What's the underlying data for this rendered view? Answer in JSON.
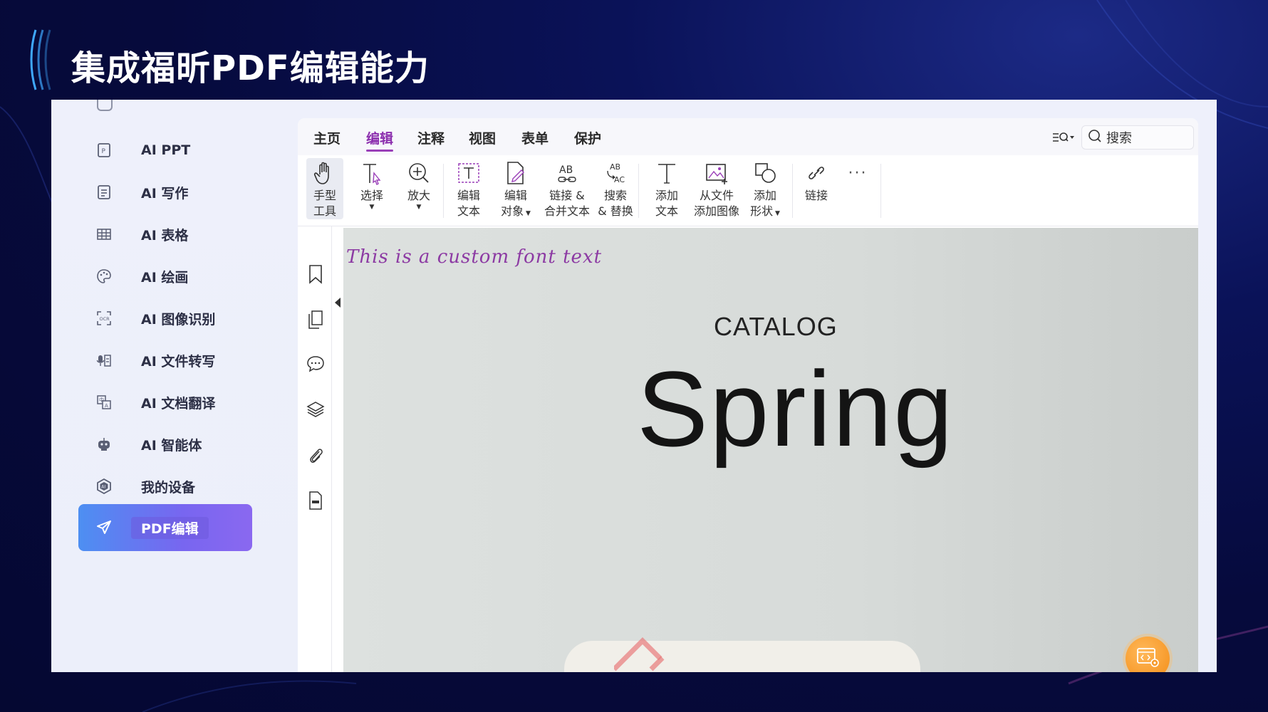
{
  "slide": {
    "title": "集成福昕PDF编辑能力"
  },
  "sidebar": {
    "items": [
      {
        "label": "AI PPT",
        "icon": "ppt-icon"
      },
      {
        "label": "AI 写作",
        "icon": "document-icon"
      },
      {
        "label": "AI 表格",
        "icon": "table-icon"
      },
      {
        "label": "AI 绘画",
        "icon": "palette-icon"
      },
      {
        "label": "AI 图像识别",
        "icon": "ocr-icon"
      },
      {
        "label": "AI 文件转写",
        "icon": "mic-file-icon"
      },
      {
        "label": "AI 文档翻译",
        "icon": "translate-icon"
      },
      {
        "label": "AI 智能体",
        "icon": "robot-icon"
      },
      {
        "label": "我的设备",
        "icon": "ai-device-icon"
      },
      {
        "label": "PDF编辑",
        "icon": "paper-plane-icon",
        "active": true
      }
    ]
  },
  "app": {
    "tabs": [
      "主页",
      "编辑",
      "注释",
      "视图",
      "表单",
      "保护"
    ],
    "active_tab": "编辑",
    "search": {
      "placeholder": "搜索"
    },
    "ribbon": {
      "hand": [
        "手型",
        "工具"
      ],
      "select": "选择",
      "zoom": "放大",
      "edit_text": [
        "编辑",
        "文本"
      ],
      "edit_object": [
        "编辑",
        "对象"
      ],
      "link_merge": [
        "链接 &",
        "合并文本"
      ],
      "search_replace": [
        "搜索",
        "& 替换"
      ],
      "add_text": [
        "添加",
        "文本"
      ],
      "add_image": [
        "从文件",
        "添加图像"
      ],
      "add_shape": [
        "添加",
        "形状"
      ],
      "link": "链接",
      "more": "···"
    },
    "document": {
      "script_text": "This is a custom font text",
      "catalog": "CATALOG",
      "headline": "Spring"
    }
  },
  "colors": {
    "accent_purple": "#8c2fae",
    "active_gradient_start": "#4d8ff2",
    "active_gradient_end": "#8a68f0",
    "fab_orange": "#f79a2a"
  }
}
